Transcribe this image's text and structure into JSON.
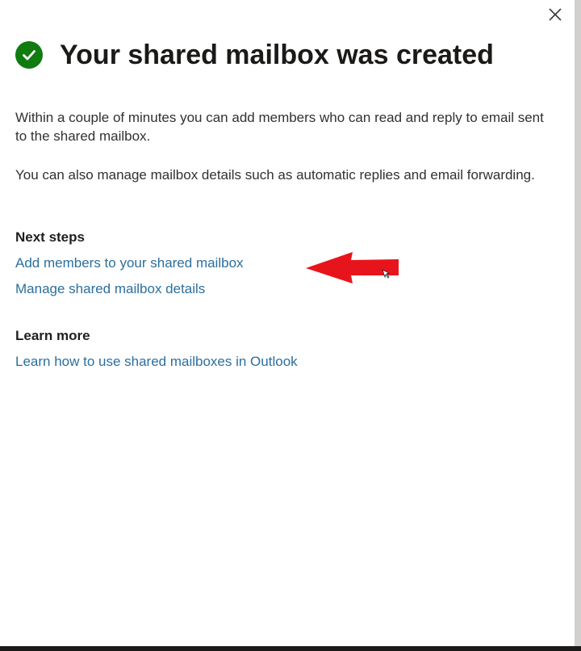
{
  "panel": {
    "title": "Your shared mailbox was created",
    "close_label": "Close",
    "paragraph_1": "Within a couple of minutes you can add members who can read and reply to email sent to the shared mailbox.",
    "paragraph_2": "You can also manage mailbox details such as automatic replies and email forwarding."
  },
  "next_steps": {
    "heading": "Next steps",
    "links": [
      "Add members to your shared mailbox",
      "Manage shared mailbox details"
    ]
  },
  "learn_more": {
    "heading": "Learn more",
    "links": [
      "Learn how to use shared mailboxes in Outlook"
    ]
  },
  "icons": {
    "success": "checkmark-circle-icon",
    "close": "close-icon",
    "annotation": "red-arrow-annotation"
  },
  "colors": {
    "success_green": "#107c10",
    "link_blue": "#2b6f9e",
    "annotation_red": "#e8141c"
  }
}
